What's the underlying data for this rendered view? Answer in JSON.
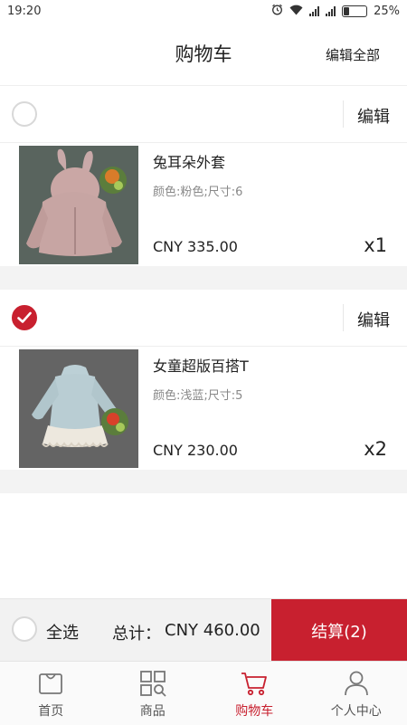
{
  "status_bar": {
    "time": "19:20",
    "battery": "25%"
  },
  "header": {
    "title": "购物车",
    "edit_all": "编辑全部"
  },
  "shops": [
    {
      "checked": false,
      "edit_label": "编辑",
      "item": {
        "name": "兔耳朵外套",
        "attributes": "颜色:粉色;尺寸:6",
        "price": "CNY 335.00",
        "quantity": "x1"
      }
    },
    {
      "checked": true,
      "edit_label": "编辑",
      "item": {
        "name": "女童超版百搭T",
        "attributes": "颜色:浅蓝;尺寸:5",
        "price": "CNY 230.00",
        "quantity": "x2"
      }
    }
  ],
  "checkout": {
    "select_all": "全选",
    "total_label": "总计：",
    "total": "CNY 460.00",
    "pay_button": "结算(2)"
  },
  "tabs": [
    {
      "label": "首页",
      "icon": "home-bag-icon"
    },
    {
      "label": "商品",
      "icon": "grid-search-icon"
    },
    {
      "label": "购物车",
      "icon": "cart-icon",
      "active": true
    },
    {
      "label": "个人中心",
      "icon": "user-icon"
    }
  ],
  "colors": {
    "accent": "#c8202f",
    "divider": "#eeeeee",
    "footer_bg": "#f2f2f2"
  }
}
